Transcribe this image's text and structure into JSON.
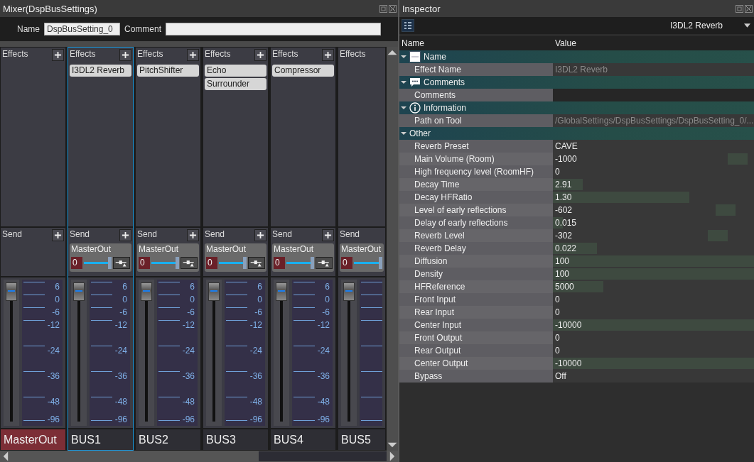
{
  "mixer": {
    "title": "Mixer(DspBusSettings)",
    "name_label": "Name",
    "name_value": "DspBusSetting_0",
    "comment_label": "Comment",
    "strips": [
      {
        "name": "MasterOut",
        "kind": "master",
        "selected": false,
        "partial": false,
        "effects_label": "Effects",
        "send_label": "Send",
        "fader": {
          "level": 0.98
        },
        "scale": [
          "6",
          "0",
          "-6",
          "-12",
          "-24",
          "-36",
          "-48",
          "-96"
        ]
      },
      {
        "name": "BUS1",
        "kind": "bus",
        "selected": true,
        "partial": false,
        "effects_label": "Effects",
        "effects": [
          "I3DL2 Reverb"
        ],
        "send_label": "Send",
        "sends": [
          {
            "target": "MasterOut",
            "value": "0",
            "level": 1
          }
        ],
        "fader": {
          "level": 0.98
        },
        "scale": [
          "6",
          "0",
          "-6",
          "-12",
          "-24",
          "-36",
          "-48",
          "-96"
        ]
      },
      {
        "name": "BUS2",
        "kind": "bus",
        "selected": false,
        "partial": false,
        "effects_label": "Effects",
        "effects": [
          "PitchShifter"
        ],
        "send_label": "Send",
        "sends": [
          {
            "target": "MasterOut",
            "value": "0",
            "level": 1
          }
        ],
        "fader": {
          "level": 0.98
        },
        "scale": [
          "6",
          "0",
          "-6",
          "-12",
          "-24",
          "-36",
          "-48",
          "-96"
        ]
      },
      {
        "name": "BUS3",
        "kind": "bus",
        "selected": false,
        "partial": false,
        "effects_label": "Effects",
        "effects": [
          "Echo",
          "Surrounder"
        ],
        "send_label": "Send",
        "sends": [
          {
            "target": "MasterOut",
            "value": "0",
            "level": 1
          }
        ],
        "fader": {
          "level": 0.98
        },
        "scale": [
          "6",
          "0",
          "-6",
          "-12",
          "-24",
          "-36",
          "-48",
          "-96"
        ]
      },
      {
        "name": "BUS4",
        "kind": "bus",
        "selected": false,
        "partial": false,
        "effects_label": "Effects",
        "effects": [
          "Compressor"
        ],
        "send_label": "Send",
        "sends": [
          {
            "target": "MasterOut",
            "value": "0",
            "level": 1
          }
        ],
        "fader": {
          "level": 0.98
        },
        "scale": [
          "6",
          "0",
          "-6",
          "-12",
          "-24",
          "-36",
          "-48",
          "-96"
        ]
      },
      {
        "name": "BUS5",
        "kind": "bus",
        "selected": false,
        "partial": true,
        "effects_label": "Effects",
        "send_label": "Send",
        "sends": [
          {
            "target": "MasterOut",
            "value": "0",
            "level": 1
          }
        ],
        "fader": {
          "level": 0.98
        }
      }
    ]
  },
  "inspector": {
    "title": "Inspector",
    "selector": "I3DL2 Reverb",
    "columns": [
      "Name",
      "Value"
    ],
    "groups": [
      {
        "title": "Name",
        "kind": "name",
        "expanded": true,
        "rows": [
          {
            "name": "Effect Name",
            "value": "I3DL2 Reverb",
            "disabled": true
          }
        ]
      },
      {
        "title": "Comments",
        "kind": "comment",
        "expanded": true,
        "rows": [
          {
            "name": "Comments",
            "kind": "edit",
            "disabled": false
          }
        ]
      },
      {
        "title": "Information",
        "kind": "info",
        "expanded": true,
        "rows": [
          {
            "name": "Path on Tool",
            "value": "/GlobalSettings/DspBusSettings/DspBusSetting_0/...",
            "disabled": true
          }
        ]
      },
      {
        "title": "Other",
        "kind": "plain",
        "expanded": true,
        "rows": [
          {
            "name": "Reverb Preset",
            "value": "CAVE",
            "disabled": false
          },
          {
            "name": "Main Volume (Room)",
            "value": "-1000",
            "disabled": false,
            "kind": "marker",
            "level": 0.92
          },
          {
            "name": "High frequency level (RoomHF)",
            "value": "0",
            "disabled": false
          },
          {
            "name": "Decay Time",
            "value": "2.91",
            "disabled": false,
            "kind": "bar",
            "level": 0.15
          },
          {
            "name": "Decay HFRatio",
            "value": "1.30",
            "disabled": false,
            "kind": "bar",
            "level": 0.68
          },
          {
            "name": "Level of early reflections",
            "value": "-602",
            "disabled": false,
            "kind": "marker",
            "level": 0.86
          },
          {
            "name": "Delay of early reflections",
            "value": "0.015",
            "disabled": false,
            "kind": "bar",
            "level": 0.05
          },
          {
            "name": "Reverb Level",
            "value": "-302",
            "disabled": false,
            "kind": "marker",
            "level": 0.82
          },
          {
            "name": "Reverb Delay",
            "value": "0.022",
            "disabled": false,
            "kind": "bar",
            "level": 0.22
          },
          {
            "name": "Diffusion",
            "value": "100",
            "disabled": false,
            "kind": "bar",
            "level": 1
          },
          {
            "name": "Density",
            "value": "100",
            "disabled": false,
            "kind": "bar",
            "level": 1
          },
          {
            "name": "HFReference",
            "value": "5000",
            "disabled": false,
            "kind": "bar",
            "level": 0.25
          },
          {
            "name": "Front Input",
            "value": "0",
            "disabled": false
          },
          {
            "name": "Rear Input",
            "value": "0",
            "disabled": false
          },
          {
            "name": "Center Input",
            "value": "-10000",
            "disabled": false,
            "kind": "bar",
            "level": 1
          },
          {
            "name": "Front Output",
            "value": "0",
            "disabled": false
          },
          {
            "name": "Rear Output",
            "value": "0",
            "disabled": false
          },
          {
            "name": "Center Output",
            "value": "-10000",
            "disabled": false,
            "kind": "bar",
            "level": 1
          },
          {
            "name": "Bypass",
            "value": "Off",
            "disabled": false
          }
        ]
      }
    ]
  }
}
